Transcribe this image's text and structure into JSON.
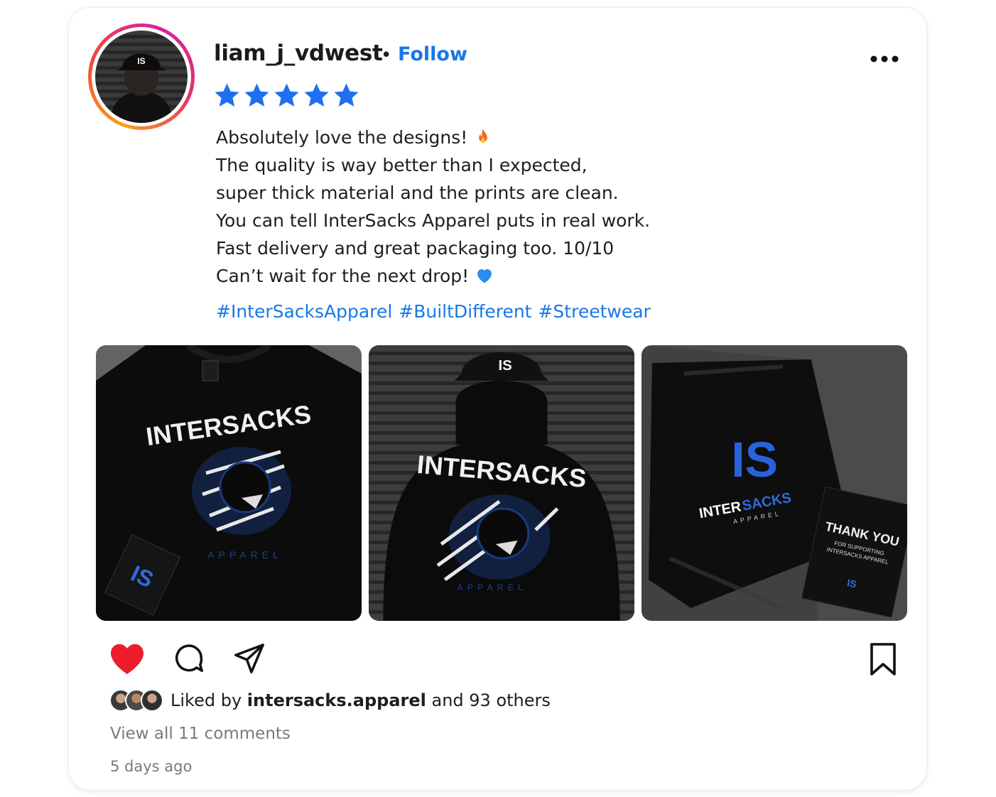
{
  "post": {
    "username": "liam_j_vdwest",
    "separator": "•",
    "follow_label": "Follow",
    "more_icon": "more-horizontal-icon",
    "rating": {
      "value": 5,
      "max": 5,
      "color": "#1f6ff0"
    },
    "review_lines": [
      "Absolutely love the designs!",
      "The quality is way better than I expected,",
      "super thick material and the prints are clean.",
      "You can tell InterSacks Apparel puts in real work.",
      "Fast delivery and great packaging too. 10/10",
      "Can’t wait for the next drop!"
    ],
    "hashtags": [
      "#InterSacksApparel",
      "#BuiltDifferent",
      "#Streetwear"
    ],
    "images": [
      {
        "subject": "black t-shirt with panther print",
        "print_title": "INTERSACKS",
        "print_sub": "APPAREL",
        "tag_logo": "IS"
      },
      {
        "subject": "black hoodie back view",
        "print_title": "INTERSACKS",
        "print_sub": "APPAREL",
        "cap_logo": "IS"
      },
      {
        "subject": "mailer bag and thank-you card",
        "logo": "IS",
        "brand_left": "INTER",
        "brand_right": "SACKS",
        "brand_sub": "APPAREL",
        "card_title": "THANK YOU",
        "card_sub1": "FOR SUPPORTING",
        "card_sub2": "INTERSACKS APPAREL",
        "card_logo": "IS"
      }
    ],
    "actions": {
      "like_icon": "heart-icon",
      "like_state": "liked",
      "like_color": "#ee1d2c",
      "comment_icon": "comment-icon",
      "share_icon": "send-icon",
      "save_icon": "bookmark-icon"
    },
    "likes": {
      "prefix": "Liked by",
      "user": "intersacks.apparel",
      "suffix": "and 93 others"
    },
    "view_comments": "View all 11 comments",
    "time": "5 days ago",
    "accent_color": "#1878e6"
  }
}
